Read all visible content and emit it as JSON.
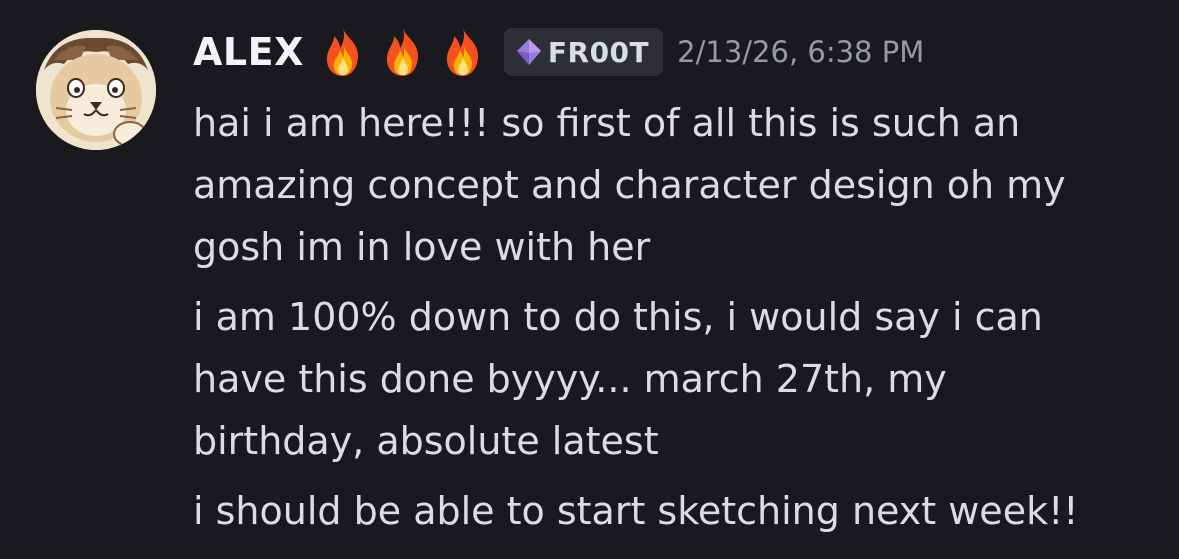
{
  "message": {
    "author": "ALEX",
    "name_decorations": [
      "fire-emoji",
      "fire-emoji",
      "fire-emoji"
    ],
    "tag": {
      "icon": "gem-icon",
      "text": "FR00T",
      "color": "#9b7bdc"
    },
    "timestamp": "2/13/26, 6:38 PM",
    "lines": [
      "hai i am here!!! so first of all this is such an",
      "amazing concept and character design oh my",
      "gosh im in love with her",
      "i am 100% down to do this, i would say i can",
      "have this done byyyy... march 27th, my",
      "birthday, absolute latest",
      "i should be able to start sketching next week!!"
    ]
  },
  "colors": {
    "background": "#1a1a1e",
    "username": "#f2f3f5",
    "text": "#dbdee1",
    "timestamp": "#949ba4",
    "tag_background": "#2e2f36"
  }
}
